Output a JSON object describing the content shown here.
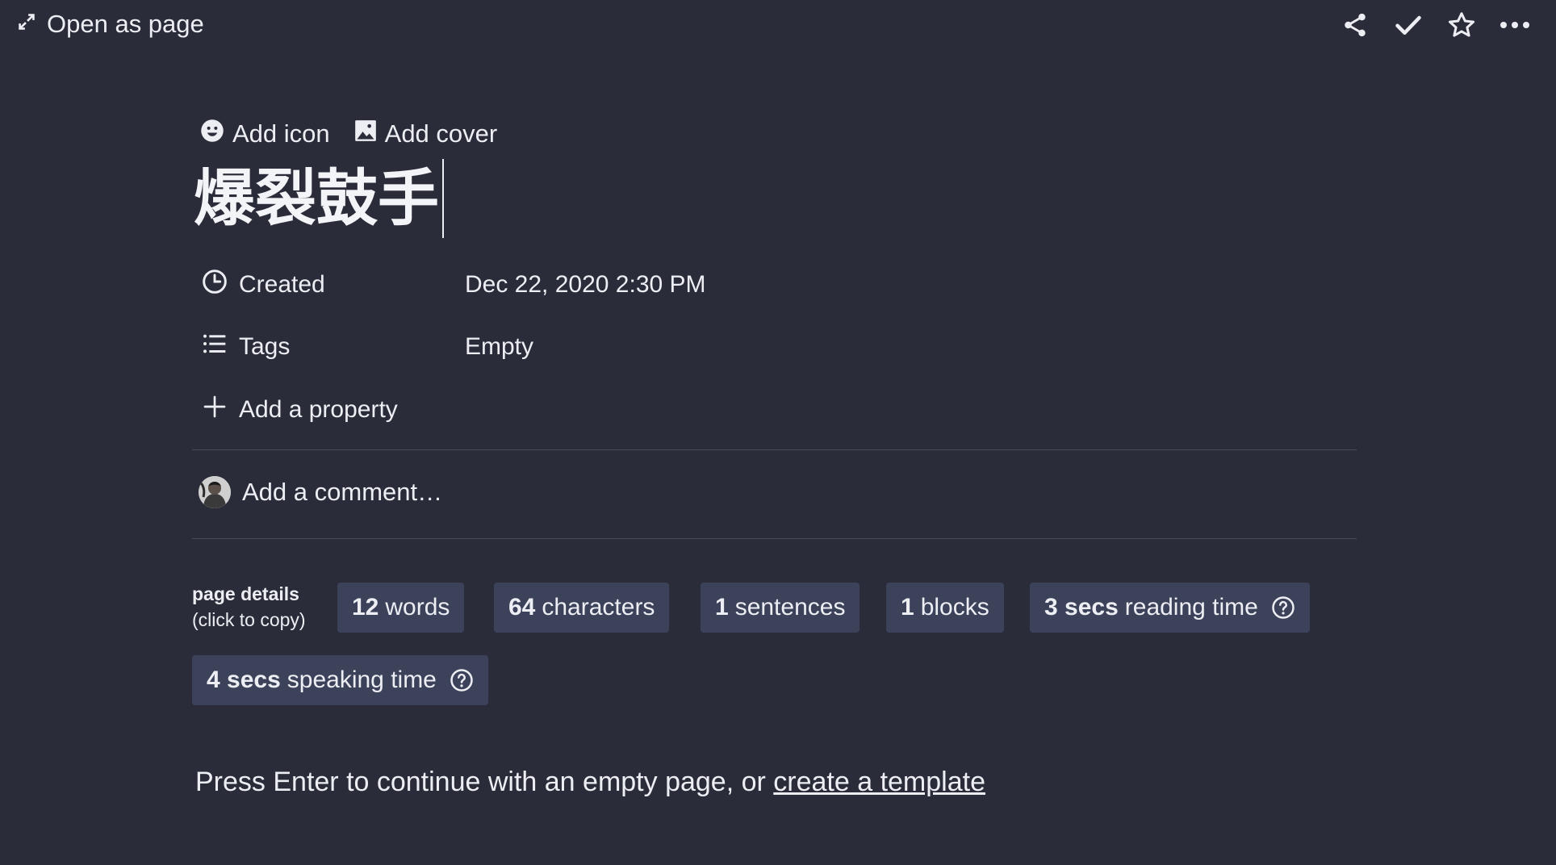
{
  "topbar": {
    "open_as_page": "Open as page",
    "icons": [
      "expand-icon",
      "share-icon",
      "check-icon",
      "star-icon",
      "more-icon"
    ]
  },
  "page": {
    "add_icon": "Add icon",
    "add_cover": "Add cover",
    "title": "爆裂鼓手"
  },
  "properties": [
    {
      "label": "Created",
      "value": "Dec 22, 2020 2:30 PM",
      "icon": "clock-icon"
    },
    {
      "label": "Tags",
      "value": "Empty",
      "icon": "list-icon"
    }
  ],
  "add_property": "Add a property",
  "comment": {
    "placeholder": "Add a comment…"
  },
  "page_details": {
    "label": "page details",
    "sublabel": "(click to copy)",
    "chips": [
      {
        "num": "12",
        "text": "words"
      },
      {
        "num": "64",
        "text": "characters"
      },
      {
        "num": "1",
        "text": "sentences"
      },
      {
        "num": "1",
        "text": "blocks"
      },
      {
        "num": "3 secs",
        "text": "reading time"
      },
      {
        "num": "4 secs",
        "text": "speaking time"
      }
    ]
  },
  "hint": {
    "text": "Press Enter to continue with an empty page, or ",
    "link": "create a template"
  },
  "colors": {
    "background": "#2a2c39",
    "chip": "#3c4259",
    "text": "#eceef3",
    "divider": "#474a57"
  }
}
